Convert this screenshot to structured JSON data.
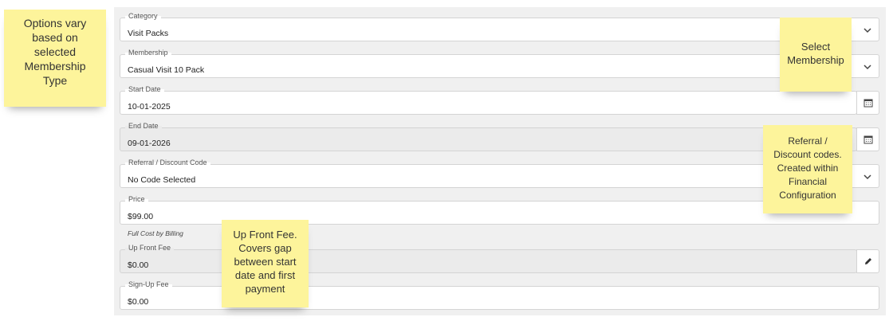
{
  "form": {
    "category": {
      "label": "Category",
      "value": "Visit Packs"
    },
    "membership": {
      "label": "Membership",
      "value": "Casual Visit 10 Pack"
    },
    "start_date": {
      "label": "Start Date",
      "value": "10-01-2025"
    },
    "end_date": {
      "label": "End Date",
      "value": "09-01-2026"
    },
    "referral": {
      "label": "Referral / Discount Code",
      "value": "No Code Selected"
    },
    "price": {
      "label": "Price",
      "value": "$99.00"
    },
    "full_cost_hint": "Full Cost by Billing",
    "up_front_fee": {
      "label": "Up Front Fee",
      "value": "$0.00"
    },
    "sign_up_fee": {
      "label": "Sign-Up Fee",
      "value": "$0.00"
    }
  },
  "notes": {
    "options_vary": "Options vary\nbased on\nselected\nMembership\nType",
    "select_membership": "Select\nMembership",
    "referral_codes": "Referral /\nDiscount codes.\nCreated within\nFinancial\nConfiguration",
    "up_front_fee": "Up Front Fee.\nCovers gap\nbetween start\ndate and first\npayment"
  },
  "colors": {
    "sticky_note": "#fdf49b",
    "panel": "#f0f0f0",
    "disabled_field": "#ebebeb"
  },
  "icons": {
    "dropdown": "chevron-down-icon",
    "date": "calendar-icon",
    "edit": "pencil-icon"
  }
}
